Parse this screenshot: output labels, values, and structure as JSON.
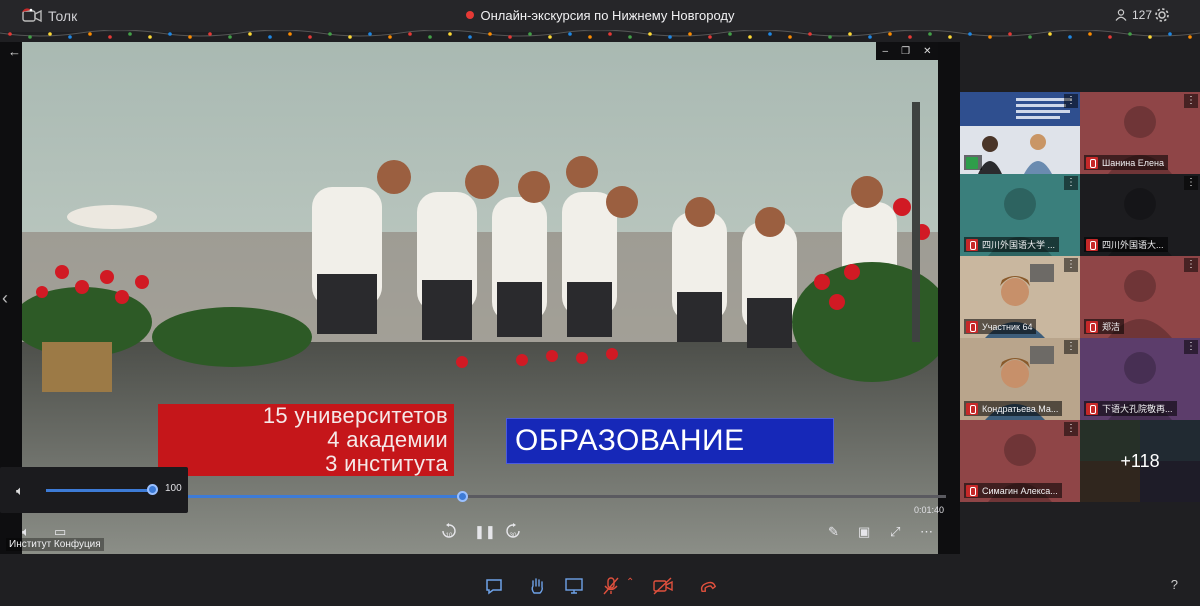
{
  "app": {
    "name": "Толк"
  },
  "window": {
    "title": "Онлайн-экскурсия по Нижнему Новгороду"
  },
  "participants_count": "127",
  "video": {
    "captions_red": [
      "15 университетов",
      "4 академии",
      "3 института"
    ],
    "caption_blue": "ОБРАЗОВАНИЕ",
    "progress": 0.365,
    "time": "0:01:40",
    "volume": "100",
    "speaker_name": "Институт Конфуция",
    "rewind_label": "10",
    "forward_label": "30"
  },
  "tiles": [
    {
      "name": "",
      "kind": "screen",
      "color": "#2b3a56"
    },
    {
      "name": "Шанина Елена",
      "kind": "avatar",
      "color": "#8f4547"
    },
    {
      "name": "四川外国语大学 ...",
      "kind": "avatar",
      "color": "#3a7f7c"
    },
    {
      "name": "四川外国语大...",
      "kind": "avatar",
      "color": "#1c1c1f"
    },
    {
      "name": "Участник 64",
      "kind": "camera",
      "color": "#c9b79f"
    },
    {
      "name": "郑洁",
      "kind": "avatar",
      "color": "#8f4547"
    },
    {
      "name": "Кондратьева Ма...",
      "kind": "camera",
      "color": "#b9a58c"
    },
    {
      "name": "下语大孔院敬再...",
      "kind": "avatar",
      "color": "#5c3d6b"
    },
    {
      "name": "Симагин Алекса...",
      "kind": "avatar",
      "color": "#8f4547"
    },
    {
      "name": "+118",
      "kind": "more",
      "color": "#2f3a44"
    }
  ],
  "icons": {
    "settings": "gear-icon",
    "participants": "people-icon",
    "chat": "chat-icon",
    "hand": "raise-hand-icon",
    "screen": "screen-share-icon",
    "mic": "mic-off-icon",
    "camera": "camera-off-icon",
    "leave": "hangup-icon",
    "help": "help-icon"
  },
  "help_label": "?"
}
